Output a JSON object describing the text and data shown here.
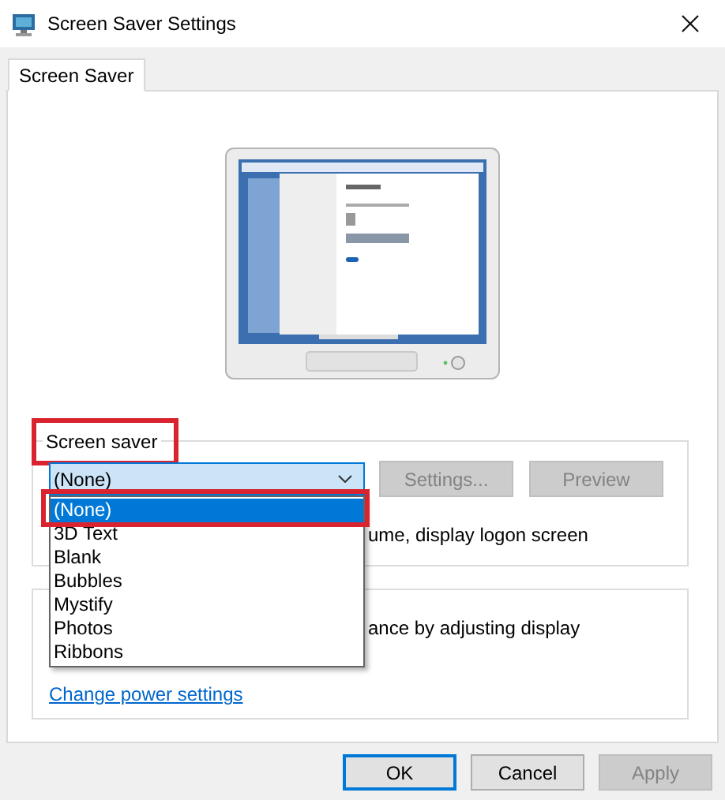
{
  "window": {
    "title": "Screen Saver Settings"
  },
  "tabs": [
    {
      "label": "Screen Saver",
      "selected": true
    }
  ],
  "screen_saver_group": {
    "title": "Screen saver",
    "title_highlighted": true,
    "dropdown": {
      "value": "(None)",
      "expanded": true,
      "options": [
        {
          "label": "(None)",
          "selected": true,
          "highlighted": true
        },
        {
          "label": "3D Text",
          "selected": false,
          "highlighted": false
        },
        {
          "label": "Blank",
          "selected": false,
          "highlighted": false
        },
        {
          "label": "Bubbles",
          "selected": false,
          "highlighted": false
        },
        {
          "label": "Mystify",
          "selected": false,
          "highlighted": false
        },
        {
          "label": "Photos",
          "selected": false,
          "highlighted": false
        },
        {
          "label": "Ribbons",
          "selected": false,
          "highlighted": false
        }
      ]
    },
    "buttons": [
      {
        "label": "Settings...",
        "disabled": true
      },
      {
        "label": "Preview",
        "disabled": true
      }
    ],
    "logon_text": "ume, display logon screen"
  },
  "power_group": {
    "text": "ance by adjusting display",
    "link": "Change power settings"
  },
  "buttons": [
    {
      "label": "OK",
      "disabled": false,
      "default": true
    },
    {
      "label": "Cancel",
      "disabled": false,
      "default": false
    },
    {
      "label": "Apply",
      "disabled": true,
      "default": false
    }
  ]
}
